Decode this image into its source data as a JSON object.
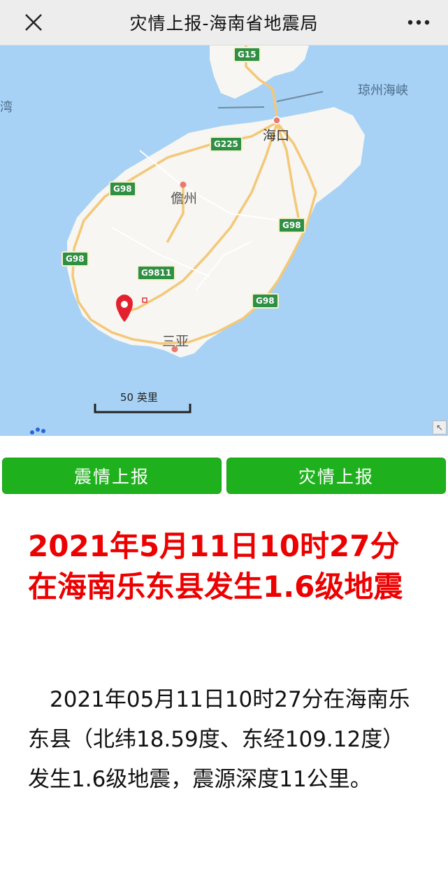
{
  "header": {
    "title": "灾情上报-海南省地震局",
    "close_icon": "close-icon",
    "more_icon": "more-icon"
  },
  "map": {
    "water_labels": {
      "strait": "琼州海峡",
      "bay": "湾"
    },
    "cities": {
      "haikou": "海口",
      "danzhou": "儋州",
      "sanya": "三亚"
    },
    "highways": {
      "g15": "G15",
      "g225": "G225",
      "g98_nw": "G98",
      "g98_w": "G98",
      "g98_e": "G98",
      "g98_se": "G98",
      "g9811": "G9811"
    },
    "scale": "50 英里",
    "marker_icon": "map-pin-icon",
    "colors": {
      "sea": "#a7d2f5",
      "land": "#f7f6f2",
      "road": "#f3c879",
      "marker": "#e5202e"
    }
  },
  "buttons": {
    "report_quake": "震情上报",
    "report_disaster": "灾情上报",
    "color": "#1fb11d"
  },
  "article": {
    "headline": "2021年5月11日10时27分在海南乐东县发生1.6级地震",
    "body": "　2021年05月11日10时27分在海南乐东县（北纬18.59度、东经109.12度）发生1.6级地震，震源深度11公里。",
    "headline_color": "#ec0000"
  }
}
